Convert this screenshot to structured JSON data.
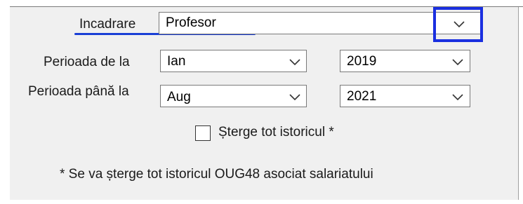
{
  "form": {
    "incadrare": {
      "label": "Incadrare",
      "value": "Profesor"
    },
    "perioada_de_la": {
      "label": "Perioada de la",
      "month": "Ian",
      "year": "2019"
    },
    "perioada_pana_la": {
      "label": "Perioada până la",
      "month": "Aug",
      "year": "2021"
    },
    "sterge_checkbox": {
      "label": "Șterge tot istoricul *",
      "checked": false
    },
    "footnote": "* Se va șterge tot istoricul OUG48 asociat salariatului"
  },
  "annotations": {
    "underline_color": "#1a3fd6",
    "highlight_color": "#1a2fe0"
  },
  "icons": {
    "dropdown": "chevron-down-icon"
  }
}
